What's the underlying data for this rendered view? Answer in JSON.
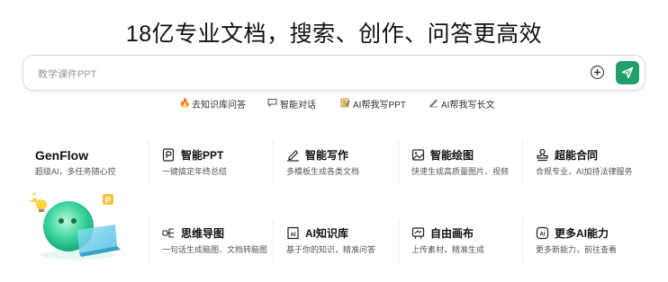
{
  "hero": {
    "title": "18亿专业文档，搜索、创作、问答更高效"
  },
  "search": {
    "placeholder": "教学课件PPT"
  },
  "quick_links": [
    {
      "label": "去知识库问答",
      "icon": "fire-icon"
    },
    {
      "label": "智能对话",
      "icon": "chat-bubble-icon"
    },
    {
      "label": "AI帮我写PPT",
      "icon": "memo-icon"
    },
    {
      "label": "AI帮我写长文",
      "icon": "pen-paper-icon"
    }
  ],
  "genflow": {
    "title": "GenFlow",
    "subtitle": "超级AI，多任务随心控"
  },
  "tools": [
    {
      "title": "智能PPT",
      "desc": "一键搞定年终总结",
      "icon": "ppt-icon"
    },
    {
      "title": "智能写作",
      "desc": "多模板生成各类文档",
      "icon": "pen-write-icon"
    },
    {
      "title": "智能绘图",
      "desc": "快速生成高质量图片、视频",
      "icon": "image-icon"
    },
    {
      "title": "超能合同",
      "desc": "合规专业，AI加持法律服务",
      "icon": "stamp-icon"
    },
    {
      "title": "思维导图",
      "desc": "一句话生成脑图、文档转脑图",
      "icon": "mindmap-icon"
    },
    {
      "title": "AI知识库",
      "desc": "基于你的知识，精准问答",
      "icon": "ai-knowledge-icon"
    },
    {
      "title": "自由画布",
      "desc": "上传素材，精准生成",
      "icon": "canvas-icon"
    },
    {
      "title": "更多AI能力",
      "desc": "更多新能力，前往查看",
      "icon": "more-ai-icon"
    }
  ],
  "colors": {
    "accent": "#22a06b",
    "text": "#111111",
    "muted": "#555555"
  }
}
